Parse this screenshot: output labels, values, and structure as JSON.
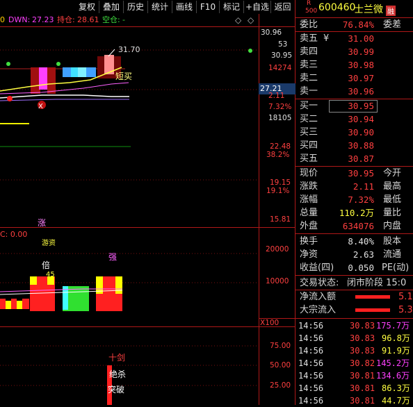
{
  "toolbar": {
    "items": [
      "复权",
      "叠加",
      "历史",
      "统计",
      "画线",
      "F10",
      "标记",
      "+自选",
      "返回"
    ]
  },
  "infoline": {
    "zero": "0",
    "dwn_label": "DWN:",
    "dwn_value": "27.23",
    "hold_label": "持仓:",
    "hold_value": "28.61",
    "empty_label": "空仓:",
    "empty_value": "-"
  },
  "price_axis": {
    "labels": [
      "30.96",
      "53",
      "30.95",
      "14274",
      "27.21",
      "2.11",
      "7.32%",
      "18105",
      "22.48",
      "38.2%",
      "19.15",
      "19.1%",
      "15.81"
    ]
  },
  "main_chart": {
    "high_label": "31.70",
    "short_buy_label": "短买",
    "zhang_label": "涨",
    "x_mark": "X"
  },
  "volume_panel": {
    "c_label": "C: 0.00",
    "axis": [
      "20000",
      "10000"
    ],
    "scale": "X100",
    "bei_label": "倍",
    "val_label": "45",
    "qiang_label": "强",
    "top_text": "游资"
  },
  "indicator_panel": {
    "axis": [
      "75.00",
      "50.00",
      "25.00"
    ],
    "shijian_label": "十剑",
    "jueshai_label": "绝杀",
    "tupo_label": "突破"
  },
  "quote": {
    "market_badge": "R",
    "market_sub": "500",
    "code": "600460",
    "name": "士兰微",
    "tag": "融",
    "weibi_label": "委比",
    "weibi_value": "76.84%",
    "weicha_label": "委差",
    "sell_levels": [
      {
        "label": "卖五",
        "mark": "¥",
        "price": "31.00"
      },
      {
        "label": "卖四",
        "mark": "",
        "price": "30.99"
      },
      {
        "label": "卖三",
        "mark": "",
        "price": "30.98"
      },
      {
        "label": "卖二",
        "mark": "",
        "price": "30.97"
      },
      {
        "label": "卖一",
        "mark": "",
        "price": "30.96"
      }
    ],
    "buy_levels": [
      {
        "label": "买一",
        "price": "30.95"
      },
      {
        "label": "买二",
        "price": "30.94"
      },
      {
        "label": "买三",
        "price": "30.90"
      },
      {
        "label": "买四",
        "price": "30.88"
      },
      {
        "label": "买五",
        "price": "30.87"
      }
    ],
    "stats": [
      {
        "label": "现价",
        "value": "30.95",
        "label2": "今开"
      },
      {
        "label": "涨跌",
        "value": "2.11",
        "label2": "最高"
      },
      {
        "label": "涨幅",
        "value": "7.32%",
        "label2": "最低"
      },
      {
        "label": "总量",
        "value": "110.2万",
        "label2": "量比"
      },
      {
        "label": "外盘",
        "value": "634076",
        "label2": "内盘"
      }
    ],
    "stats2": [
      {
        "label": "换手",
        "value": "8.40%",
        "label2": "股本"
      },
      {
        "label": "净资",
        "value": "2.63",
        "label2": "流通"
      },
      {
        "label": "收益(四)",
        "value": "0.050",
        "label2": "PE(动)"
      }
    ],
    "trade_status_label": "交易状态:",
    "trade_status_value": "闭市阶段 15:0",
    "flow": [
      {
        "label": "净流入额",
        "value": "5.1"
      },
      {
        "label": "大宗流入",
        "value": "5.3"
      }
    ],
    "ticks": [
      {
        "time": "14:56",
        "price": "30.83",
        "vol": "175.7万"
      },
      {
        "time": "14:56",
        "price": "30.83",
        "vol": "96.8万"
      },
      {
        "time": "14:56",
        "price": "30.83",
        "vol": "91.9万"
      },
      {
        "time": "14:56",
        "price": "30.82",
        "vol": "145.2万"
      },
      {
        "time": "14:56",
        "price": "30.81",
        "vol": "134.6万"
      },
      {
        "time": "14:56",
        "price": "30.81",
        "vol": "86.3万"
      },
      {
        "time": "14:56",
        "price": "30.81",
        "vol": "44.7万"
      }
    ]
  }
}
